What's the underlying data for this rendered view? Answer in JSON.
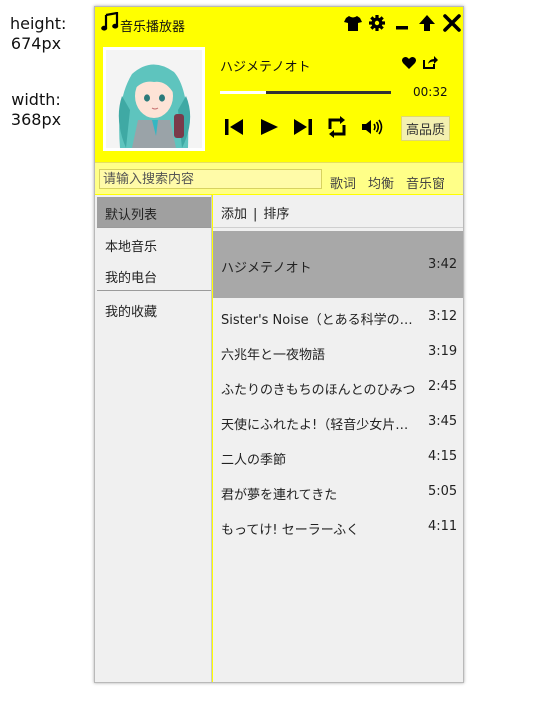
{
  "annotations": {
    "height": "height:\n674px",
    "width": "width:\n368px"
  },
  "window": {
    "title": "音乐播放器"
  },
  "player": {
    "track_title": "ハジメテノオト",
    "current_time": "00:32",
    "progress_fraction": 0.27,
    "quality_label": "高品质"
  },
  "search": {
    "placeholder": "请输入搜索内容",
    "value": "",
    "tabs": [
      "歌词",
      "均衡",
      "音乐窗"
    ]
  },
  "sidebar": {
    "items": [
      {
        "label": "默认列表",
        "selected": true
      },
      {
        "label": "本地音乐",
        "selected": false
      },
      {
        "label": "我的电台",
        "selected": false
      },
      {
        "label": "我的收藏",
        "selected": false
      }
    ]
  },
  "playlist": {
    "add_label": "添加",
    "separator": "|",
    "sort_label": "排序",
    "songs": [
      {
        "title": "ハジメテノオト",
        "duration": "3:42",
        "playing": true
      },
      {
        "title": "Sister's Noise（とある科学の超電磁砲S）",
        "duration": "3:12",
        "playing": false
      },
      {
        "title": "六兆年と一夜物語",
        "duration": "3:19",
        "playing": false
      },
      {
        "title": "ふたりのきもちのほんとのひみつ",
        "duration": "2:45",
        "playing": false
      },
      {
        "title": "天使にふれたよ!（轻音少女片尾曲）",
        "duration": "3:45",
        "playing": false
      },
      {
        "title": "二人の季節",
        "duration": "4:15",
        "playing": false
      },
      {
        "title": "君が夢を連れてきた",
        "duration": "5:05",
        "playing": false
      },
      {
        "title": "もってけ! セーラーふく",
        "duration": "4:11",
        "playing": false
      }
    ]
  },
  "icons": {
    "app": "music-note-icon",
    "skin": "tshirt-icon",
    "settings": "gear-icon",
    "minimize": "minimize-icon",
    "mini_mode": "arrow-up-icon",
    "close": "close-icon",
    "favorite": "heart-icon",
    "share": "share-icon",
    "previous": "skip-back-icon",
    "play": "play-icon",
    "next": "skip-forward-icon",
    "loop": "repeat-icon",
    "volume": "volume-icon"
  },
  "colors": {
    "theme": "#ffff00",
    "accent_light": "#ffff88",
    "selected": "#a0a0a0"
  }
}
